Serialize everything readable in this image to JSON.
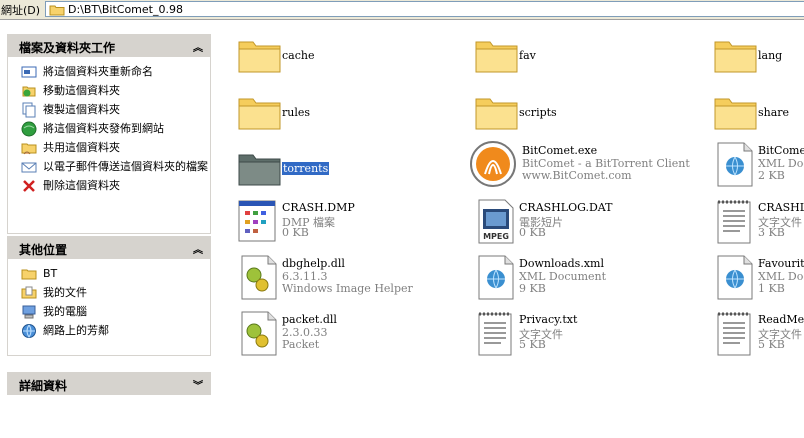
{
  "address": {
    "label": "網址(D)",
    "path": "D:\\BT\\BitComet_0.98"
  },
  "tasks_panel": {
    "title": "檔案及資料夾工作",
    "items": [
      {
        "label": "將這個資料夾重新命名",
        "icon": "rename-icon"
      },
      {
        "label": "移動這個資料夾",
        "icon": "move-icon"
      },
      {
        "label": "複製這個資料夾",
        "icon": "copy-icon"
      },
      {
        "label": "將這個資料夾發佈到網站",
        "icon": "publish-web-icon"
      },
      {
        "label": "共用這個資料夾",
        "icon": "share-folder-icon"
      },
      {
        "label": "以電子郵件傳送這個資料夾的檔案",
        "icon": "email-icon"
      },
      {
        "label": "刪除這個資料夾",
        "icon": "delete-icon"
      }
    ]
  },
  "places_panel": {
    "title": "其他位置",
    "items": [
      {
        "label": "BT",
        "icon": "folder-icon"
      },
      {
        "label": "我的文件",
        "icon": "my-documents-icon"
      },
      {
        "label": "我的電腦",
        "icon": "my-computer-icon"
      },
      {
        "label": "網路上的芳鄰",
        "icon": "network-icon"
      }
    ]
  },
  "details_panel": {
    "title": "詳細資料"
  },
  "files": [
    {
      "name": "cache",
      "type": "folder"
    },
    {
      "name": "fav",
      "type": "folder"
    },
    {
      "name": "lang",
      "type": "folder"
    },
    {
      "name": "rules",
      "type": "folder"
    },
    {
      "name": "scripts",
      "type": "folder"
    },
    {
      "name": "share",
      "type": "folder"
    },
    {
      "name": "torrents",
      "type": "folder-selected"
    },
    {
      "name": "BitComet.exe",
      "l2": "BitComet - a BitTorrent Client",
      "l3": "www.BitComet.com",
      "type": "bitcomet"
    },
    {
      "name": "BitComet",
      "l2": "XML Doc",
      "l3": "2 KB",
      "type": "xml"
    },
    {
      "name": "CRASH.DMP",
      "l2": "DMP 檔案",
      "l3": "0 KB",
      "type": "dmp"
    },
    {
      "name": "CRASHLOG.DAT",
      "l2": "電影短片",
      "l3": "0 KB",
      "type": "mpeg"
    },
    {
      "name": "CRASHL",
      "l2": "文字文件",
      "l3": "3 KB",
      "type": "text"
    },
    {
      "name": "dbghelp.dll",
      "l2": "6.3.11.3",
      "l3": "Windows Image Helper",
      "type": "dll"
    },
    {
      "name": "Downloads.xml",
      "l2": "XML Document",
      "l3": "9 KB",
      "type": "xml"
    },
    {
      "name": "Favourite",
      "l2": "XML Doc",
      "l3": "1 KB",
      "type": "xml"
    },
    {
      "name": "packet.dll",
      "l2": "2.3.0.33",
      "l3": "Packet",
      "type": "dll"
    },
    {
      "name": "Privacy.txt",
      "l2": "文字文件",
      "l3": "5 KB",
      "type": "text"
    },
    {
      "name": "ReadMe.t",
      "l2": "文字文件",
      "l3": "5 KB",
      "type": "text"
    }
  ]
}
